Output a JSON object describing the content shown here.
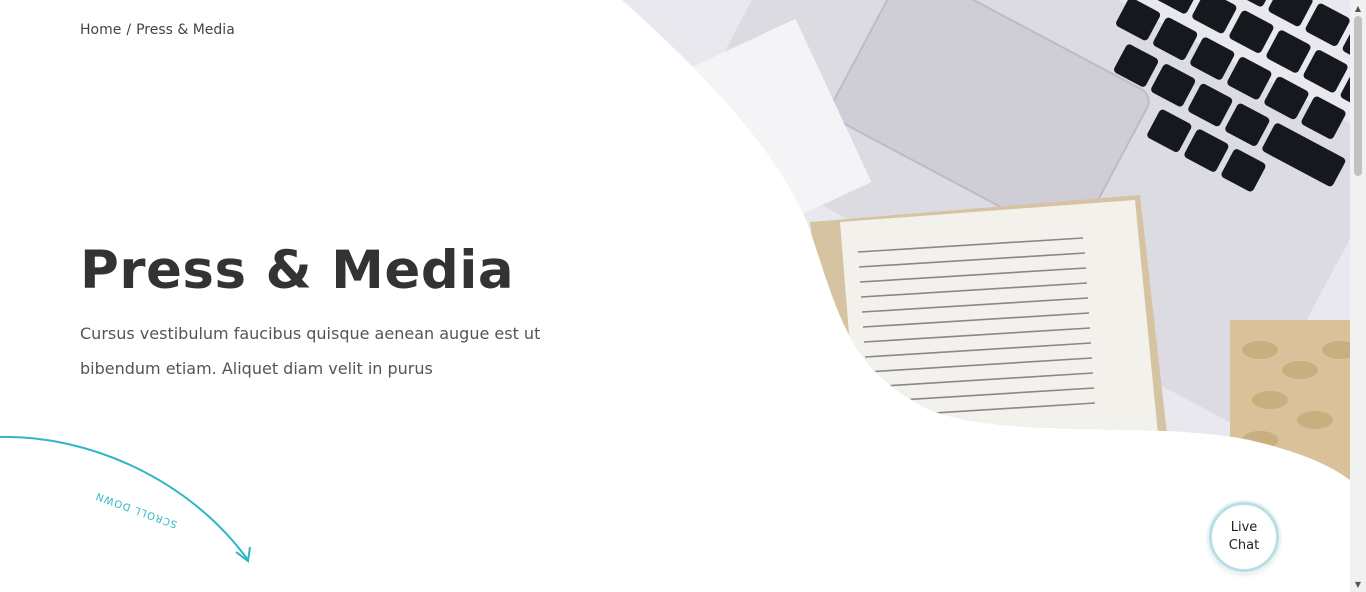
{
  "breadcrumb": {
    "home": "Home",
    "separator": "/",
    "current": "Press & Media"
  },
  "hero": {
    "title": "Press & Media",
    "subtitle": "Cursus vestibulum faucibus quisque aenean augue est ut bibendum etiam. Aliquet diam velit in purus"
  },
  "scroll": {
    "label": "SCROLL DOWN"
  },
  "chat": {
    "label": "Live Chat"
  },
  "colors": {
    "accent": "#2fb5c8",
    "title": "#333333",
    "text": "#555555"
  },
  "icons": {
    "scroll_arrow": "curved-arrow-icon",
    "scroll_up": "triangle-up",
    "scroll_down": "triangle-down"
  }
}
